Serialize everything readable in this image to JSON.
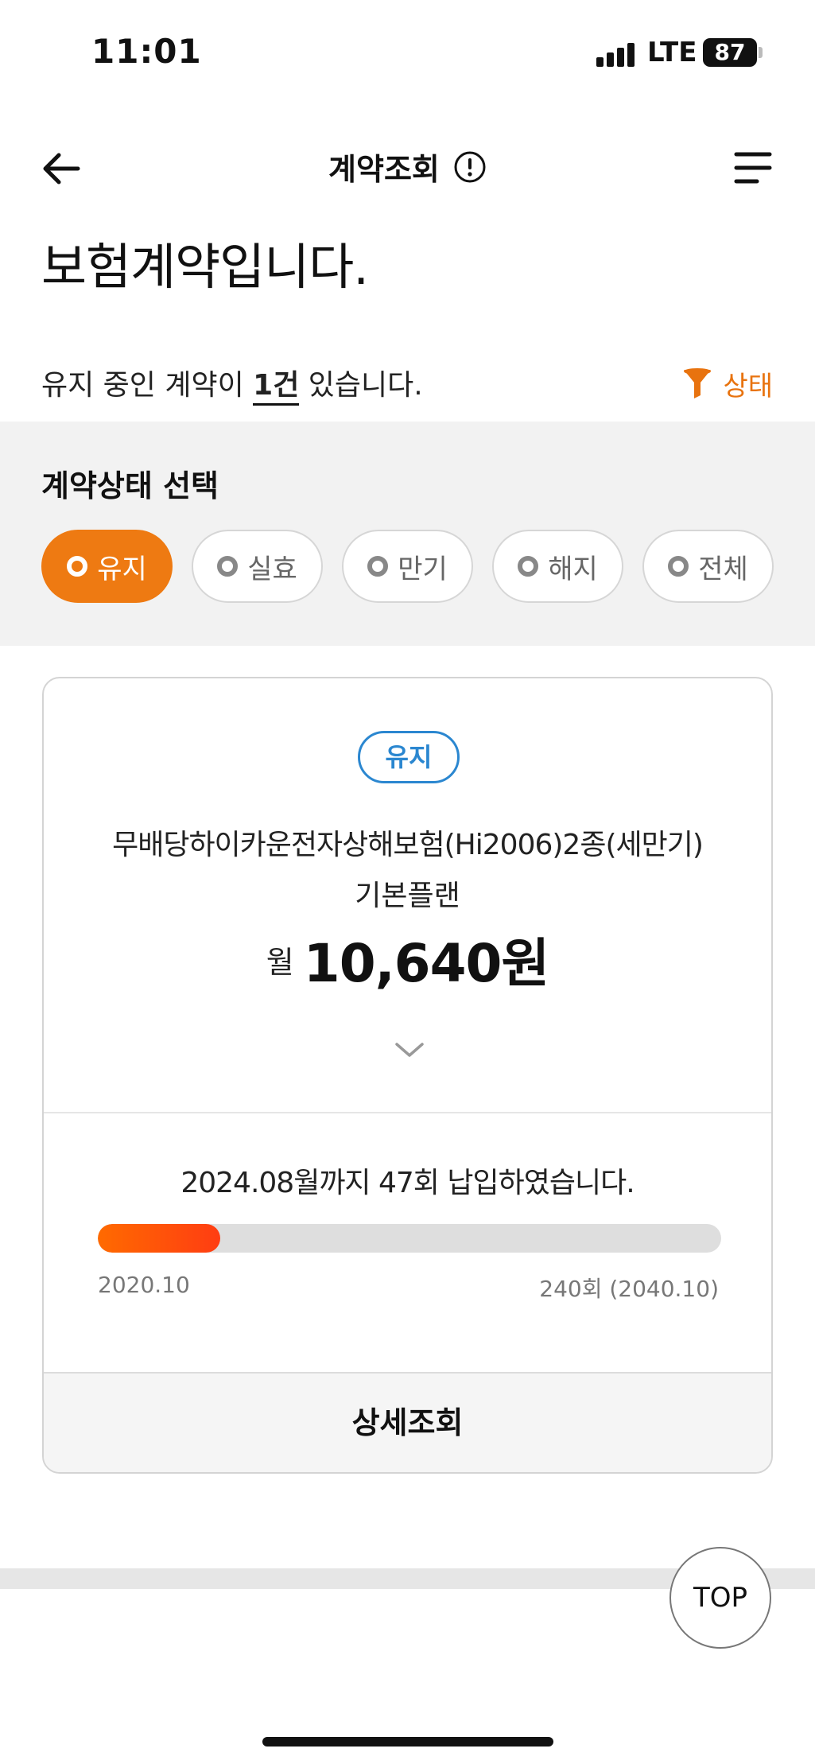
{
  "status_bar": {
    "time": "11:01",
    "network": "LTE",
    "battery": "87"
  },
  "header": {
    "title": "계약조회",
    "back_icon": "arrow-left-icon",
    "info_icon": "info-icon",
    "menu_icon": "hamburger-menu-icon"
  },
  "page": {
    "title": "보험계약입니다."
  },
  "summary": {
    "prefix": "유지 중인 계약이 ",
    "count": "1건",
    "suffix": " 있습니다.",
    "filter_label": "상태",
    "filter_icon": "funnel-icon"
  },
  "status_filter": {
    "title": "계약상태 선택",
    "options": [
      {
        "label": "유지",
        "selected": true
      },
      {
        "label": "실효",
        "selected": false
      },
      {
        "label": "만기",
        "selected": false
      },
      {
        "label": "해지",
        "selected": false
      },
      {
        "label": "전체",
        "selected": false
      }
    ]
  },
  "contract": {
    "status_badge": "유지",
    "product_name": "무배당하이카운전자상해보험(Hi2006)2종(세만기)",
    "plan_name": "기본플랜",
    "premium_prefix": "월",
    "premium_amount": "10,640원",
    "paid_text": "2024.08월까지 47회 납입하였습니다.",
    "progress": {
      "paid_count": 47,
      "total_count": 240,
      "start_label": "2020.10",
      "end_label": "240회 (2040.10)"
    },
    "detail_button": "상세조회"
  },
  "colors": {
    "accent": "#ee7a12",
    "badge_blue": "#2b87d0",
    "progress": "#ff5a0a"
  },
  "top_button": "TOP"
}
